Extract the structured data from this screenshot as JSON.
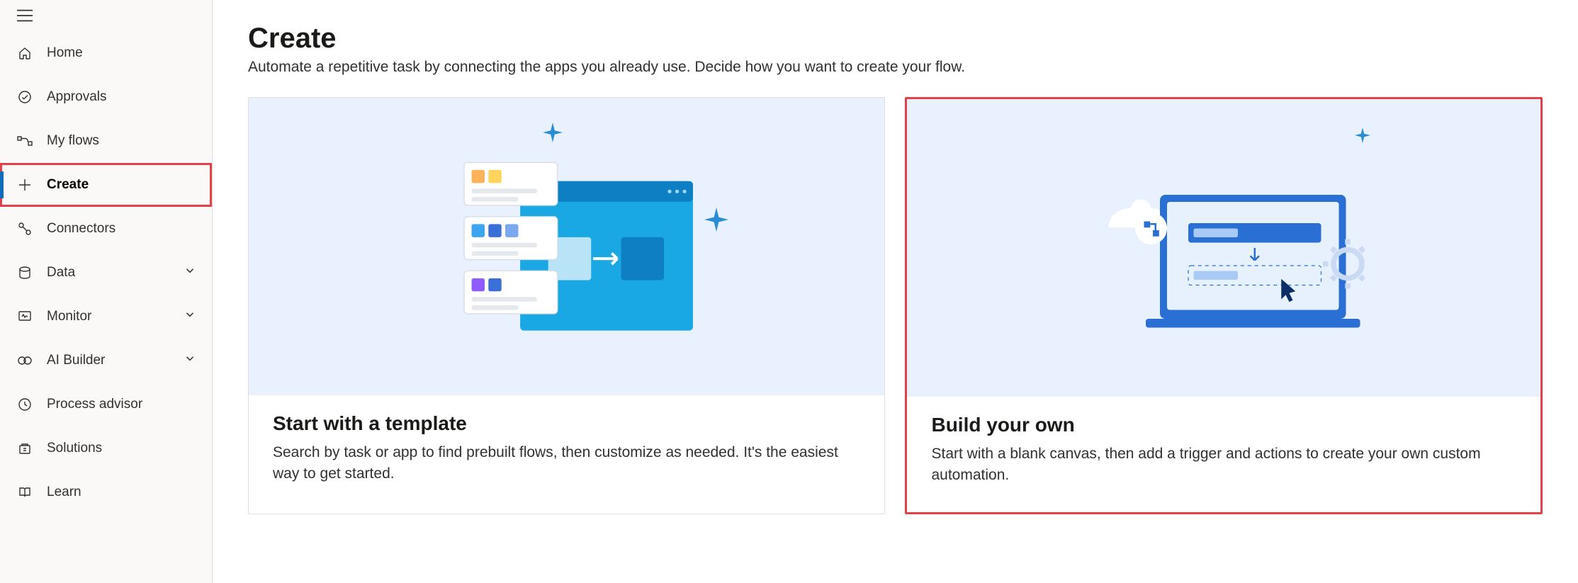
{
  "sidebar": {
    "items": [
      {
        "icon": "home",
        "label": "Home"
      },
      {
        "icon": "approval",
        "label": "Approvals"
      },
      {
        "icon": "flow",
        "label": "My flows"
      },
      {
        "icon": "plus",
        "label": "Create",
        "active": true,
        "highlight": true
      },
      {
        "icon": "connect",
        "label": "Connectors"
      },
      {
        "icon": "data",
        "label": "Data",
        "expandable": true
      },
      {
        "icon": "monitor",
        "label": "Monitor",
        "expandable": true
      },
      {
        "icon": "ai",
        "label": "AI Builder",
        "expandable": true
      },
      {
        "icon": "process",
        "label": "Process advisor"
      },
      {
        "icon": "solution",
        "label": "Solutions"
      },
      {
        "icon": "learn",
        "label": "Learn"
      }
    ]
  },
  "header": {
    "title": "Create",
    "subtitle": "Automate a repetitive task by connecting the apps you already use. Decide how you want to create your flow."
  },
  "cards": [
    {
      "title": "Start with a template",
      "desc": "Search by task or app to find prebuilt flows, then customize as needed. It's the easiest way to get started.",
      "highlight": false
    },
    {
      "title": "Build your own",
      "desc": "Start with a blank canvas, then add a trigger and actions to create your own custom automation.",
      "highlight": true
    }
  ]
}
